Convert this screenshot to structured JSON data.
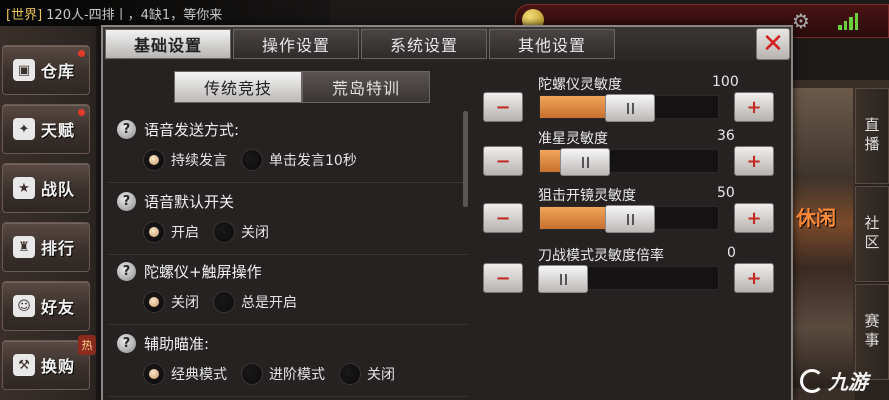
{
  "chat": {
    "channel": "[世界]",
    "message": "120人-四排丨，4缺1，等你来"
  },
  "sidebar": {
    "items": [
      {
        "label": "仓库",
        "icon": "warehouse-icon",
        "dot": true
      },
      {
        "label": "天赋",
        "icon": "talent-icon",
        "dot": true
      },
      {
        "label": "战队",
        "icon": "team-icon",
        "dot": false
      },
      {
        "label": "排行",
        "icon": "trophy-icon",
        "dot": false
      },
      {
        "label": "好友",
        "icon": "friends-icon",
        "dot": false
      },
      {
        "label": "换购",
        "icon": "exchange-icon",
        "dot": false
      }
    ],
    "hot_badge": "热"
  },
  "right_panel": {
    "banner_text": "休闲",
    "tabs": [
      "直播",
      "社区",
      "赛事"
    ]
  },
  "watermark": "九游",
  "dialog": {
    "tabs": [
      {
        "label": "基础设置",
        "active": true
      },
      {
        "label": "操作设置",
        "active": false
      },
      {
        "label": "系统设置",
        "active": false
      },
      {
        "label": "其他设置",
        "active": false
      }
    ],
    "close_label": "✕",
    "subtabs": [
      {
        "label": "传统竞技",
        "active": true
      },
      {
        "label": "荒岛特训",
        "active": false
      }
    ],
    "options": [
      {
        "title": "语音发送方式:",
        "choices": [
          {
            "label": "持续发言",
            "selected": true
          },
          {
            "label": "单击发言10秒",
            "selected": false
          }
        ]
      },
      {
        "title": "语音默认开关",
        "choices": [
          {
            "label": "开启",
            "selected": true
          },
          {
            "label": "关闭",
            "selected": false
          }
        ]
      },
      {
        "title": "陀螺仪+触屏操作",
        "choices": [
          {
            "label": "关闭",
            "selected": true
          },
          {
            "label": "总是开启",
            "selected": false
          }
        ]
      },
      {
        "title": "辅助瞄准:",
        "choices": [
          {
            "label": "经典模式",
            "selected": true
          },
          {
            "label": "进阶模式",
            "selected": false
          },
          {
            "label": "关闭",
            "selected": false
          }
        ]
      }
    ],
    "sliders": [
      {
        "label": "陀螺仪灵敏度",
        "value": "100",
        "fraction": 0.36
      },
      {
        "label": "准星灵敏度",
        "value": "36",
        "fraction": 0.11
      },
      {
        "label": "狙击开镜灵敏度",
        "value": "50",
        "fraction": 0.36
      },
      {
        "label": "刀战模式灵敏度倍率",
        "value": "0",
        "fraction": 0.0
      }
    ],
    "minus_label": "−",
    "plus_label": "+"
  },
  "colors": {
    "accent_orange": "#e08a40",
    "close_red": "#d41e1e",
    "signal_green": "#6ccf3c"
  }
}
